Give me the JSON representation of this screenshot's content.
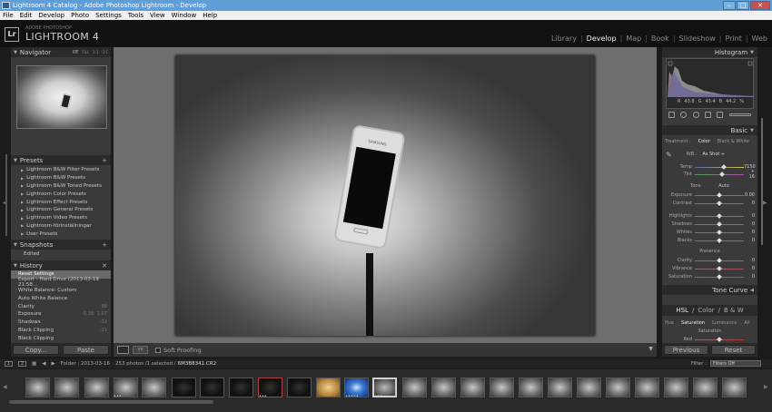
{
  "window": {
    "title": "Lightroom 4 Catalog - Adobe Photoshop Lightroom - Develop",
    "controls": {
      "minimize": "–",
      "maximize": "□",
      "close": "✕"
    }
  },
  "menu": [
    "File",
    "Edit",
    "Develop",
    "Photo",
    "Settings",
    "Tools",
    "View",
    "Window",
    "Help"
  ],
  "identity": {
    "badge": "Lr",
    "adobe": "ADOBE PHOTOSHOP",
    "product": "LIGHTROOM 4"
  },
  "modules": [
    "Library",
    "Develop",
    "Map",
    "Book",
    "Slideshow",
    "Print",
    "Web"
  ],
  "active_module": "Develop",
  "left": {
    "navigator": {
      "title": "Navigator",
      "zoom": [
        "FIT",
        "FILL",
        "1:1",
        "3:1"
      ]
    },
    "presets": {
      "title": "Presets",
      "items": [
        "Lightroom B&W Filter Presets",
        "Lightroom B&W Presets",
        "Lightroom B&W Toned Presets",
        "Lightroom Color Presets",
        "Lightroom Effect Presets",
        "Lightroom General Presets",
        "Lightroom Video Presets",
        "Lightroom-förinställningar",
        "User Presets"
      ]
    },
    "snapshots": {
      "title": "Snapshots",
      "items": [
        "Edited"
      ]
    },
    "history": {
      "title": "History",
      "items": [
        {
          "label": "Reset Settings",
          "v1": "",
          "v2": ""
        },
        {
          "label": "Export - Hard Drive (2013-03-19 21:58...",
          "v1": "",
          "v2": ""
        },
        {
          "label": "White Balance: Custom",
          "v1": "",
          "v2": ""
        },
        {
          "label": "Auto White Balance",
          "v1": "",
          "v2": ""
        },
        {
          "label": "Clarity",
          "v1": "",
          "v2": "88"
        },
        {
          "label": "Exposure",
          "v1": "-0.38",
          "v2": "1.07"
        },
        {
          "label": "Shadows",
          "v1": "",
          "v2": "-32"
        },
        {
          "label": "Black Clipping",
          "v1": "",
          "v2": "-11"
        },
        {
          "label": "Black Clipping",
          "v1": "",
          "v2": ""
        }
      ]
    },
    "copy_label": "Copy...",
    "paste_label": "Paste"
  },
  "toolbar": {
    "soft_proofing": "Soft Proofing",
    "compare_label": "YY"
  },
  "photo": {
    "brand": "SAMSUNG"
  },
  "right": {
    "histogram": {
      "title": "Histogram",
      "r": "R",
      "r_val": "43.8",
      "g": "G",
      "g_val": "43.4",
      "b": "B",
      "b_val": "44.2",
      "pct": "%"
    },
    "basic": {
      "title": "Basic",
      "treatment": "Treatment :",
      "color": "Color",
      "bw": "Black & White",
      "wb_label": "WB :",
      "wb_value": "As Shot ÷",
      "tone_label": "Tone",
      "auto_label": "Auto",
      "presence_label": "Presence",
      "sliders": [
        {
          "label": "Temp",
          "value": "7150"
        },
        {
          "label": "Tint",
          "value": "+ 16"
        },
        {
          "label": "Exposure",
          "value": "0.00"
        },
        {
          "label": "Contrast",
          "value": "0"
        },
        {
          "label": "Highlights",
          "value": "0"
        },
        {
          "label": "Shadows",
          "value": "0"
        },
        {
          "label": "Whites",
          "value": "0"
        },
        {
          "label": "Blacks",
          "value": "0"
        },
        {
          "label": "Clarity",
          "value": "0"
        },
        {
          "label": "Vibrance",
          "value": "0"
        },
        {
          "label": "Saturation",
          "value": "0"
        }
      ]
    },
    "tone_curve": {
      "title": "Tone Curve"
    },
    "hsl": {
      "hsl": "HSL",
      "sep": "/",
      "color": "Color",
      "bw": "B & W"
    },
    "hsl_tabs": [
      "Hue",
      "Saturation",
      "Luminance",
      "All"
    ],
    "hsl_section": "Saturation",
    "hsl_first": "Red",
    "previous_label": "Previous",
    "reset_label": "Reset"
  },
  "filmstrip": {
    "page1": "1",
    "page2": "2",
    "folder": "Folder : 2013-03-16",
    "count": "253 photos /1 selected /",
    "file": "6M3B8341.CR2",
    "filter_label": "Filter :",
    "filter_value": "Filters Off"
  },
  "colors": {
    "titlebar": "#5f9ed6",
    "panel": "#3a3a3a",
    "header": "#2a2a2a",
    "center_bg": "#6e6e6e",
    "active_text": "#eeeeee"
  }
}
